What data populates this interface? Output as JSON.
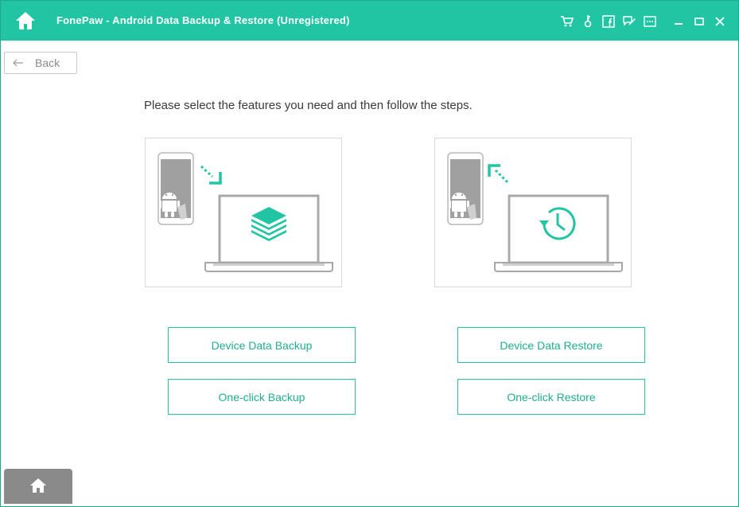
{
  "window": {
    "title": "FonePaw - Android Data Backup & Restore (Unregistered)"
  },
  "titlebar": {
    "icons": [
      "home-icon",
      "cart-icon",
      "key-icon",
      "facebook-icon",
      "feedback-icon",
      "menu-icon",
      "minimize-icon",
      "maximize-icon",
      "close-icon"
    ]
  },
  "nav": {
    "back_label": "Back"
  },
  "main": {
    "instruction": "Please select the features you need and then follow the steps.",
    "backup": {
      "device_button": "Device Data Backup",
      "oneclick_button": "One-click Backup"
    },
    "restore": {
      "device_button": "Device Data Restore",
      "oneclick_button": "One-click Restore"
    }
  },
  "colors": {
    "accent": "#22c5a3",
    "button_text": "#1fae90",
    "device_gray": "#9b9b9b",
    "bottom_tab": "#8a8a8a"
  }
}
